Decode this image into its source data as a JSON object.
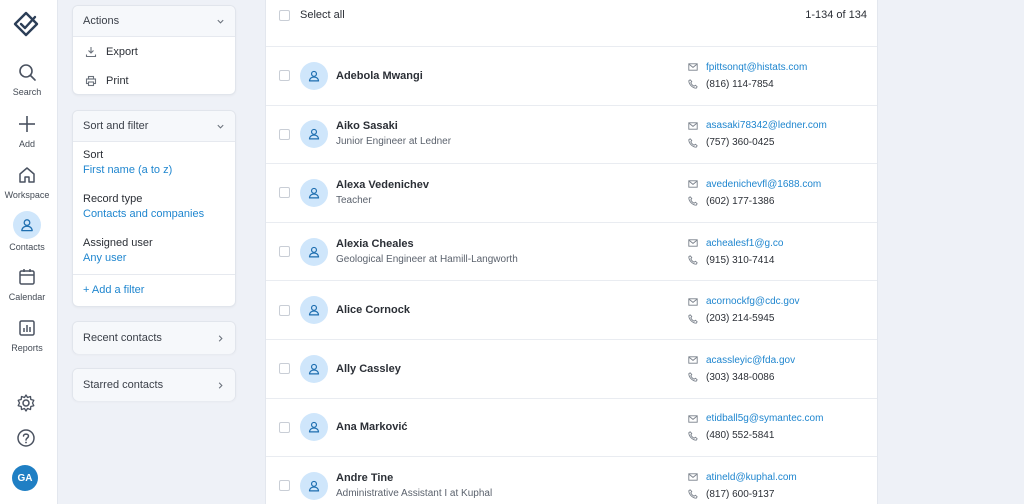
{
  "rail": {
    "items": [
      {
        "label": "Search",
        "icon": "search-icon"
      },
      {
        "label": "Add",
        "icon": "plus-icon"
      },
      {
        "label": "Workspace",
        "icon": "home-icon"
      },
      {
        "label": "Contacts",
        "icon": "person-icon"
      },
      {
        "label": "Calendar",
        "icon": "calendar-icon"
      },
      {
        "label": "Reports",
        "icon": "chart-icon"
      }
    ],
    "avatar_initials": "GA"
  },
  "actions": {
    "title": "Actions",
    "items": [
      {
        "label": "Export",
        "icon": "download-icon"
      },
      {
        "label": "Print",
        "icon": "printer-icon"
      }
    ]
  },
  "sort_filter": {
    "title": "Sort and filter",
    "sort_label": "Sort",
    "sort_value": "First name (a to z)",
    "record_type_label": "Record type",
    "record_type_value": "Contacts and companies",
    "assigned_label": "Assigned user",
    "assigned_value": "Any user",
    "add_filter": "+ Add a filter"
  },
  "recent_contacts": "Recent contacts",
  "starred_contacts": "Starred contacts",
  "list": {
    "select_all": "Select all",
    "count": "1-134 of 134",
    "contacts": [
      {
        "name": "Adebola Mwangi",
        "title": "",
        "email": "fpittsonqt@histats.com",
        "phone": "(816) 114-7854"
      },
      {
        "name": "Aiko Sasaki",
        "title": "Junior Engineer at Ledner",
        "email": "asasaki78342@ledner.com",
        "phone": "(757) 360-0425"
      },
      {
        "name": "Alexa Vedenichev",
        "title": "Teacher",
        "email": "avedenichevfl@1688.com",
        "phone": "(602) 177-1386"
      },
      {
        "name": "Alexia Cheales",
        "title": "Geological Engineer at Hamill-Langworth",
        "email": "achealesf1@g.co",
        "phone": "(915) 310-7414"
      },
      {
        "name": "Alice Cornock",
        "title": "",
        "email": "acornockfg@cdc.gov",
        "phone": "(203) 214-5945"
      },
      {
        "name": "Ally Cassley",
        "title": "",
        "email": "acassleyic@fda.gov",
        "phone": "(303) 348-0086"
      },
      {
        "name": "Ana Marković",
        "title": "",
        "email": "etidball5g@symantec.com",
        "phone": "(480) 552-5841"
      },
      {
        "name": "Andre Tine",
        "title": "Administrative Assistant I at Kuphal",
        "email": "atineld@kuphal.com",
        "phone": "(817) 600-9137"
      }
    ]
  },
  "colors": {
    "accent": "#1f86cf",
    "avatar_bg": "#cfe6fb",
    "page_bg": "#eef1f7"
  }
}
